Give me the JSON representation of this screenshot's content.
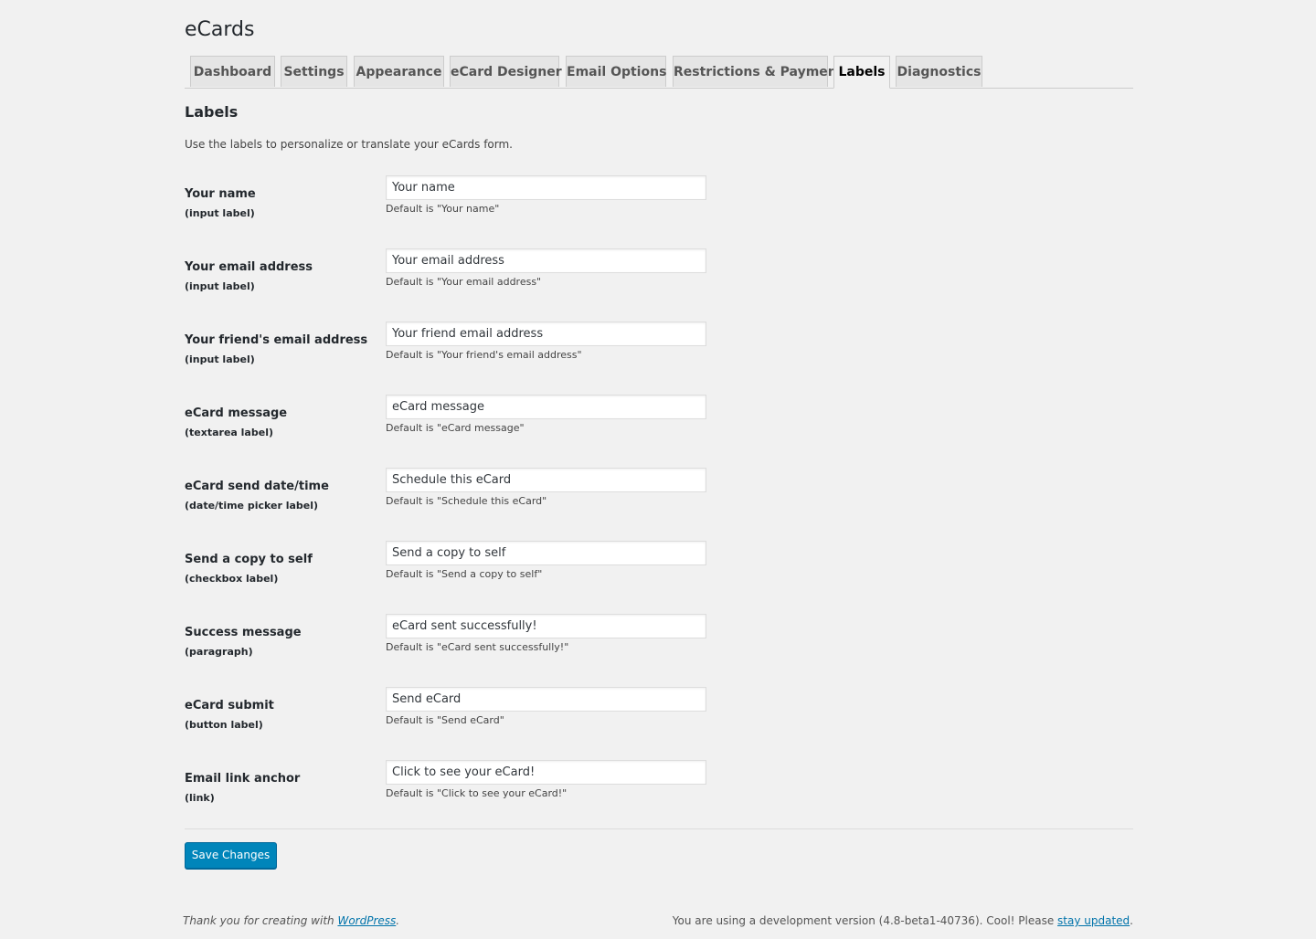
{
  "page": {
    "title": "eCards",
    "section_title": "Labels",
    "intro": "Use the labels to personalize or translate your eCards form."
  },
  "tabs": [
    {
      "label": "Dashboard",
      "active": false
    },
    {
      "label": "Settings",
      "active": false
    },
    {
      "label": "Appearance",
      "active": false
    },
    {
      "label": "eCard Designer",
      "active": false
    },
    {
      "label": "Email Options",
      "active": false
    },
    {
      "label": "Restrictions & Payment",
      "active": false
    },
    {
      "label": "Labels",
      "active": true
    },
    {
      "label": "Diagnostics",
      "active": false
    }
  ],
  "fields": [
    {
      "label": "Your name",
      "sub": "(input label)",
      "value": "Your name",
      "description": "Default is \"Your name\""
    },
    {
      "label": "Your email address",
      "sub": "(input label)",
      "value": "Your email address",
      "description": "Default is \"Your email address\""
    },
    {
      "label": "Your friend's email address",
      "sub": "(input label)",
      "value": "Your friend email address",
      "description": "Default is \"Your friend's email address\""
    },
    {
      "label": "eCard message",
      "sub": "(textarea label)",
      "value": "eCard message",
      "description": "Default is \"eCard message\""
    },
    {
      "label": "eCard send date/time",
      "sub": "(date/time picker label)",
      "value": "Schedule this eCard",
      "description": "Default is \"Schedule this eCard\""
    },
    {
      "label": "Send a copy to self",
      "sub": "(checkbox label)",
      "value": "Send a copy to self",
      "description": "Default is \"Send a copy to self\""
    },
    {
      "label": "Success message",
      "sub": "(paragraph)",
      "value": "eCard sent successfully!",
      "description": "Default is \"eCard sent successfully!\""
    },
    {
      "label": "eCard submit",
      "sub": "(button label)",
      "value": "Send eCard",
      "description": "Default is \"Send eCard\""
    },
    {
      "label": "Email link anchor",
      "sub": "(link)",
      "value": "Click to see your eCard!",
      "description": "Default is \"Click to see your eCard!\""
    }
  ],
  "save_button": "Save Changes",
  "footer": {
    "left_text": "Thank you for creating with ",
    "left_link": "WordPress",
    "left_end": ".",
    "right_text": "You are using a development version (4.8-beta1-40736). Cool! Please ",
    "right_link": "stay updated",
    "right_end": "."
  },
  "colors": {
    "background": "#f1f1f1",
    "primary_button": "#0085ba",
    "link": "#0073aa"
  }
}
